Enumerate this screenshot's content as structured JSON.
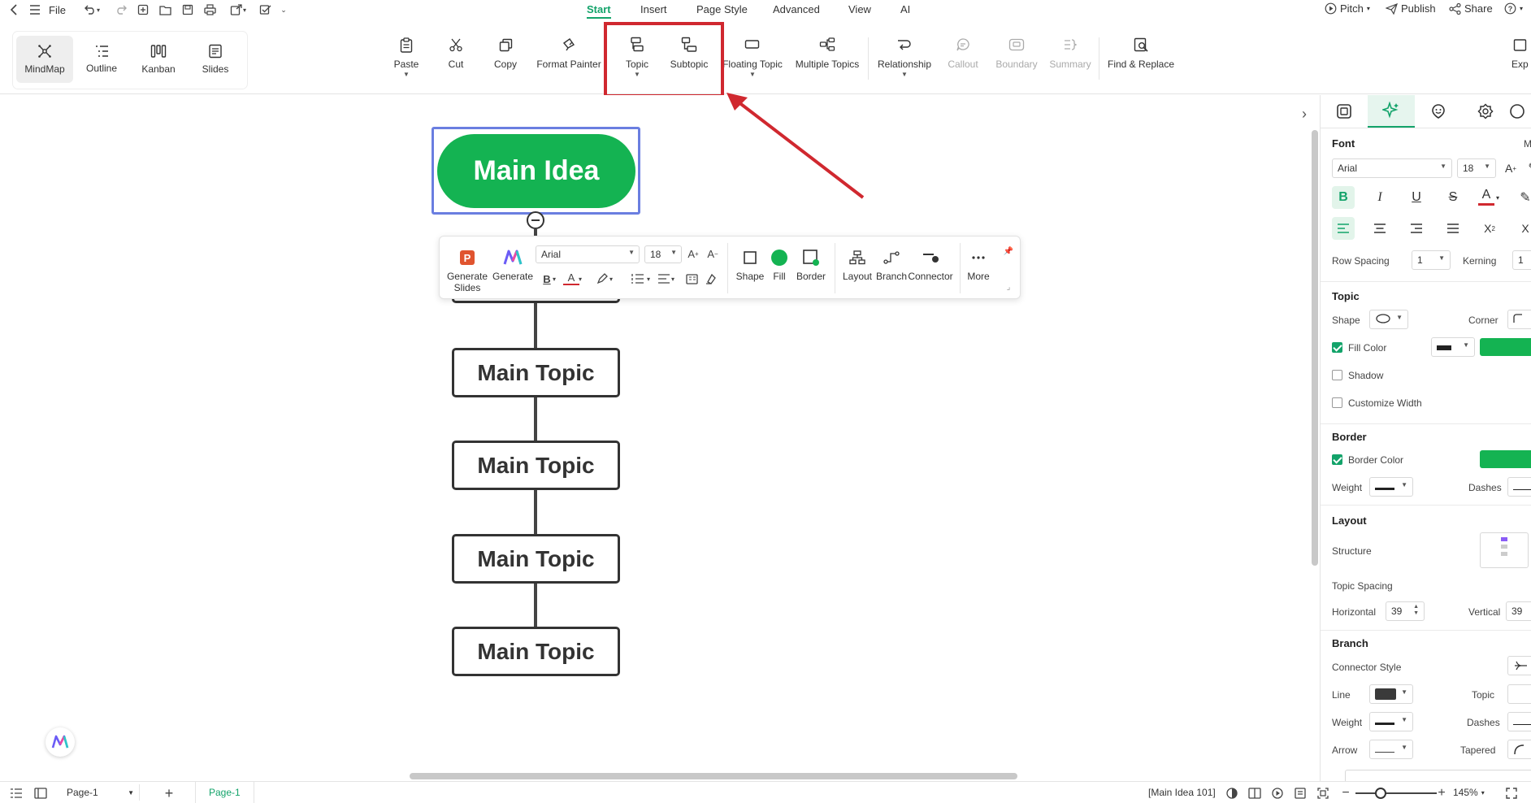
{
  "menu": {
    "file_label": "File",
    "tabs": [
      "Start",
      "Insert",
      "Page Style",
      "Advanced",
      "View",
      "AI"
    ],
    "active_tab": "Start",
    "pitch_label": "Pitch",
    "publish_label": "Publish",
    "share_label": "Share",
    "help_label": "?"
  },
  "view_switch": {
    "items": [
      {
        "label": "MindMap",
        "icon": "mindmap-icon"
      },
      {
        "label": "Outline",
        "icon": "outline-icon"
      },
      {
        "label": "Kanban",
        "icon": "kanban-icon"
      },
      {
        "label": "Slides",
        "icon": "slides-icon"
      }
    ],
    "active": "MindMap"
  },
  "ribbon": {
    "paste": "Paste",
    "cut": "Cut",
    "copy": "Copy",
    "format_painter": "Format Painter",
    "topic": "Topic",
    "subtopic": "Subtopic",
    "floating_topic": "Floating Topic",
    "multiple_topics": "Multiple Topics",
    "relationship": "Relationship",
    "callout": "Callout",
    "boundary": "Boundary",
    "summary": "Summary",
    "find_replace": "Find & Replace",
    "export_partial": "Exp"
  },
  "canvas": {
    "main_idea": "Main Idea",
    "topics": [
      "Main Topic",
      "Main Topic",
      "Main Topic",
      "Main Topic"
    ],
    "accent_color": "#14b352",
    "selection_color": "#6a7ee0",
    "highlight_color": "#d0282f"
  },
  "float_toolbar": {
    "generate_slides": "Generate Slides",
    "generate": "Generate",
    "font": "Arial",
    "size": "18",
    "shape": "Shape",
    "fill": "Fill",
    "border": "Border",
    "layout": "Layout",
    "branch": "Branch",
    "connector": "Connector",
    "more": "More"
  },
  "panel": {
    "font_section": "Font",
    "font_right_partial": "M",
    "font_family": "Arial",
    "font_size": "18",
    "row_spacing_label": "Row Spacing",
    "row_spacing_value": "1",
    "kerning_label": "Kerning",
    "kerning_value": "1",
    "topic_section": "Topic",
    "shape_label": "Shape",
    "corner_label": "Corner",
    "fill_color_label": "Fill Color",
    "shadow_label": "Shadow",
    "customize_width_label": "Customize Width",
    "border_section": "Border",
    "border_color_label": "Border Color",
    "weight_label": "Weight",
    "dashes_label": "Dashes",
    "layout_section": "Layout",
    "structure_label": "Structure",
    "topic_spacing_label": "Topic Spacing",
    "horizontal_label": "Horizontal",
    "horizontal_value": "39",
    "vertical_label": "Vertical",
    "vertical_value": "39",
    "branch_section": "Branch",
    "connector_style_label": "Connector Style",
    "line_label": "Line",
    "topic_label": "Topic",
    "weight2_label": "Weight",
    "dashes2_label": "Dashes",
    "arrow_label": "Arrow",
    "tapered_label": "Tapered",
    "fill_color": "#14b352",
    "border_color": "#14b352",
    "line_color": "#3a3a3a"
  },
  "status": {
    "page_select": "Page-1",
    "page_tab": "Page-1",
    "selection_info": "[Main Idea 101]",
    "zoom": "145%"
  }
}
